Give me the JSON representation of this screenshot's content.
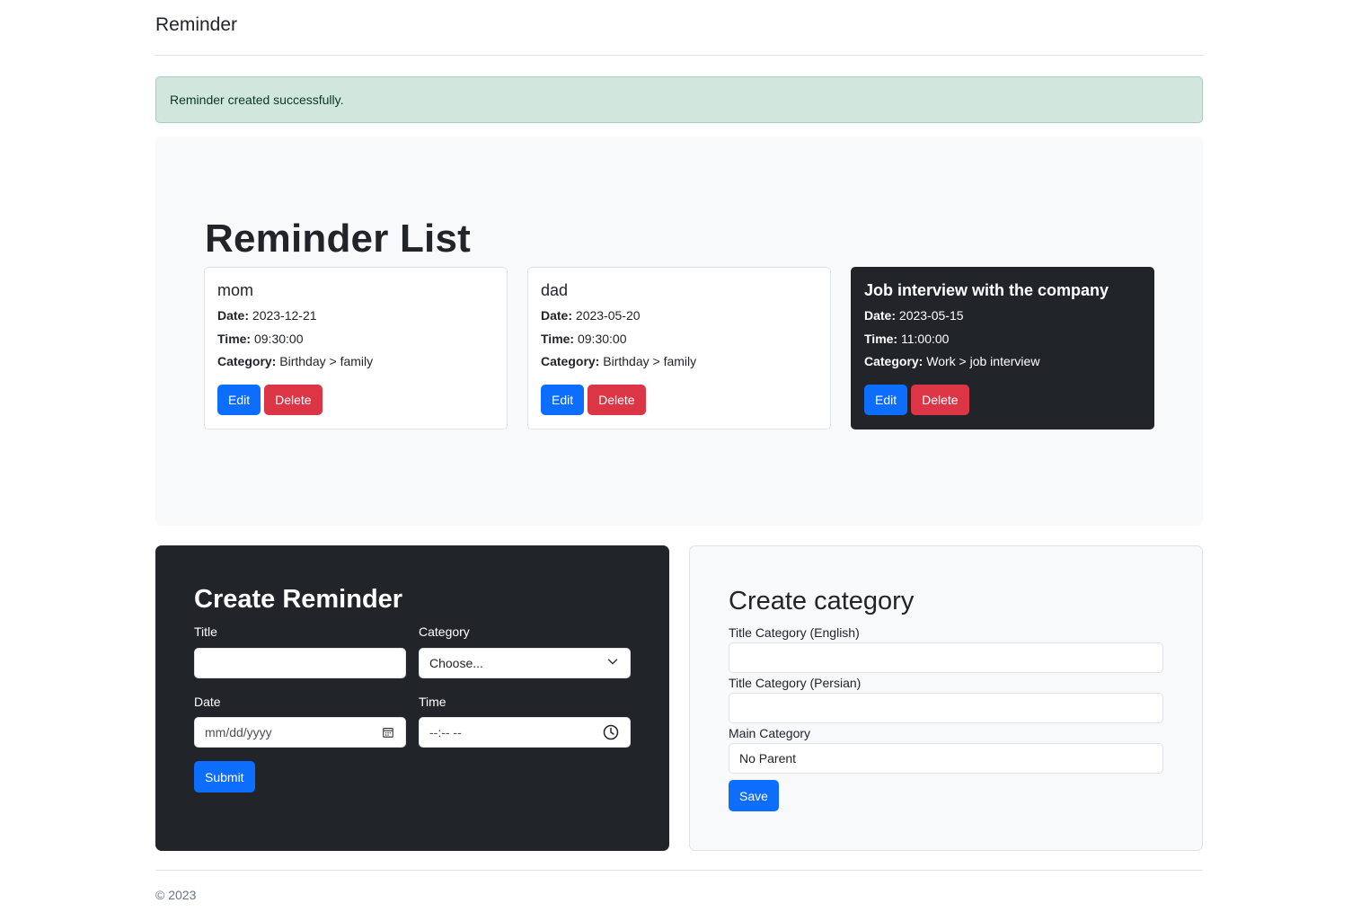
{
  "app": {
    "brand": "Reminder"
  },
  "alert": {
    "message": "Reminder created successfully."
  },
  "list": {
    "heading": "Reminder List",
    "reminders": [
      {
        "title": "mom",
        "date_label": "Date:",
        "date": "2023-12-21",
        "time_label": "Time:",
        "time": "09:30:00",
        "category_label": "Category:",
        "category": "Birthday > family",
        "edit": "Edit",
        "delete": "Delete"
      },
      {
        "title": "dad",
        "date_label": "Date:",
        "date": "2023-05-20",
        "time_label": "Time:",
        "time": "09:30:00",
        "category_label": "Category:",
        "category": "Birthday > family",
        "edit": "Edit",
        "delete": "Delete"
      },
      {
        "title": "Job interview with the company",
        "date_label": "Date:",
        "date": "2023-05-15",
        "time_label": "Time:",
        "time": "11:00:00",
        "category_label": "Category:",
        "category": "Work > job interview",
        "edit": "Edit",
        "delete": "Delete"
      }
    ]
  },
  "create_reminder": {
    "heading": "Create Reminder",
    "title_label": "Title",
    "title_value": "",
    "category_label": "Category",
    "category_selected": "Choose...",
    "date_label": "Date",
    "date_placeholder": "mm/dd/yyyy",
    "time_label": "Time",
    "time_placeholder": "--:-- --",
    "submit": "Submit"
  },
  "create_category": {
    "heading": "Create category",
    "title_en_label": "Title Category (English)",
    "title_en_value": "",
    "title_fa_label": "Title Category (Persian)",
    "title_fa_value": "",
    "main_label": "Main Category",
    "main_selected": "No Parent",
    "save": "Save"
  },
  "footer": {
    "text": "© 2023"
  },
  "colors": {
    "primary": "#0d6efd",
    "danger": "#dc3545",
    "dark": "#212529",
    "success_bg": "#d1e7dd"
  }
}
